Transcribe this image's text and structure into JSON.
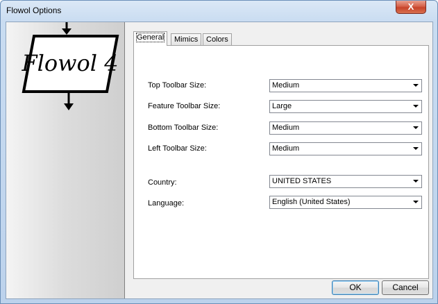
{
  "window": {
    "title": "Flowol Options",
    "close_glyph": "X"
  },
  "logo": {
    "text": "Flowol 4"
  },
  "tabs": [
    {
      "label": "General",
      "active": true
    },
    {
      "label": "Mimics",
      "active": false
    },
    {
      "label": "Colors",
      "active": false
    }
  ],
  "general": {
    "top_toolbar": {
      "label": "Top Toolbar Size:",
      "value": "Medium"
    },
    "feature_toolbar": {
      "label": "Feature Toolbar Size:",
      "value": "Large"
    },
    "bottom_toolbar": {
      "label": "Bottom Toolbar Size:",
      "value": "Medium"
    },
    "left_toolbar": {
      "label": "Left Toolbar Size:",
      "value": "Medium"
    },
    "country": {
      "label": "Country:",
      "value": "UNITED STATES"
    },
    "language": {
      "label": "Language:",
      "value": "English (United States)"
    }
  },
  "buttons": {
    "ok": "OK",
    "cancel": "Cancel"
  },
  "colors": {
    "title_bar_top": "#dbe8f6",
    "close_red": "#c7432a",
    "default_button_border": "#3c7fb1"
  }
}
